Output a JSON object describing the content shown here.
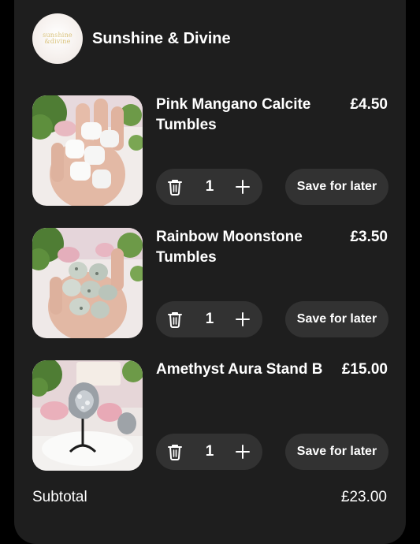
{
  "shop": {
    "name": "Sunshine & Divine",
    "logo_line1": "sunshine",
    "logo_line2": "&divine"
  },
  "items": [
    {
      "title": "Pink Mangano Calcite Tumbles",
      "price": "£4.50",
      "quantity": "1",
      "save_label": "Save for later"
    },
    {
      "title": "Rainbow Moonstone Tumbles",
      "price": "£3.50",
      "quantity": "1",
      "save_label": "Save for later"
    },
    {
      "title": "Amethyst Aura Stand B",
      "price": "£15.00",
      "quantity": "1",
      "save_label": "Save for later"
    }
  ],
  "summary": {
    "subtotal_label": "Subtotal",
    "subtotal_value": "£23.00"
  },
  "icons": {
    "delete": "trash-icon",
    "increase": "plus-icon"
  },
  "colors": {
    "card_background": "#1e1e1e",
    "pill_background": "#323232",
    "text": "#ffffff"
  }
}
